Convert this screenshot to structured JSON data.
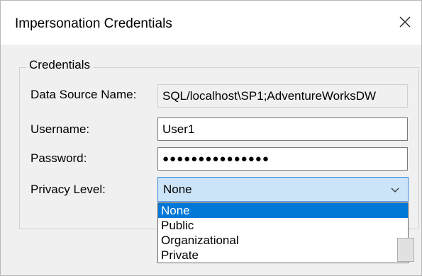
{
  "window": {
    "title": "Impersonation Credentials"
  },
  "groupbox": {
    "legend": "Credentials"
  },
  "fields": {
    "data_source": {
      "label": "Data Source Name:",
      "value": "SQL/localhost\\SP1;AdventureWorksDW"
    },
    "username": {
      "label": "Username:",
      "value": "User1"
    },
    "password": {
      "label": "Password:",
      "value": "●●●●●●●●●●●●●●●"
    },
    "privacy": {
      "label": "Privacy Level:",
      "value": "None"
    }
  },
  "privacy_options": [
    "None",
    "Public",
    "Organizational",
    "Private"
  ],
  "icons": {
    "close": "close-icon",
    "dropdown": "chevron-down-icon"
  },
  "colors": {
    "selection": "#0078d7",
    "select_focus_bg": "#cce4f7",
    "select_focus_border": "#3c8ee0"
  }
}
